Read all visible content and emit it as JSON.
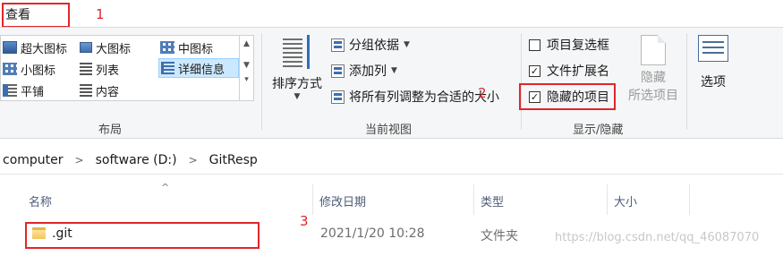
{
  "tabs": {
    "view": "查看"
  },
  "annotations": {
    "step1": "1",
    "step2": "2",
    "step3": "3",
    "color": "#e0262b"
  },
  "layout_group": {
    "label": "布局",
    "items": [
      {
        "label": "超大图标",
        "icon": "extra-large-icons-icon"
      },
      {
        "label": "大图标",
        "icon": "large-icons-icon"
      },
      {
        "label": "中图标",
        "icon": "medium-icons-icon"
      },
      {
        "label": "小图标",
        "icon": "small-icons-icon"
      },
      {
        "label": "列表",
        "icon": "list-icon"
      },
      {
        "label": "详细信息",
        "icon": "details-icon",
        "selected": true
      },
      {
        "label": "平铺",
        "icon": "tiles-icon"
      },
      {
        "label": "内容",
        "icon": "content-icon"
      }
    ]
  },
  "current_view_group": {
    "label": "当前视图",
    "sort_by": "排序方式",
    "group_by": "分组依据",
    "add_columns": "添加列",
    "size_all_columns": "将所有列调整为合适的大小"
  },
  "show_hide_group": {
    "label": "显示/隐藏",
    "item_checkboxes": {
      "label": "项目复选框",
      "checked": false
    },
    "file_extensions": {
      "label": "文件扩展名",
      "checked": true
    },
    "hidden_items": {
      "label": "隐藏的项目",
      "checked": true
    },
    "hide_selected": [
      "隐藏",
      "所选项目"
    ]
  },
  "options": {
    "label": "选项"
  },
  "address": {
    "crumbs": [
      "computer",
      "software (D:)",
      "GitResp"
    ]
  },
  "columns": {
    "name": "名称",
    "date": "修改日期",
    "type": "类型",
    "size": "大小"
  },
  "rows": [
    {
      "name": ".git",
      "date": "2021/1/20 10:28",
      "type": "文件夹",
      "size": ""
    }
  ],
  "watermark": "https://blog.csdn.net/qq_46087070"
}
